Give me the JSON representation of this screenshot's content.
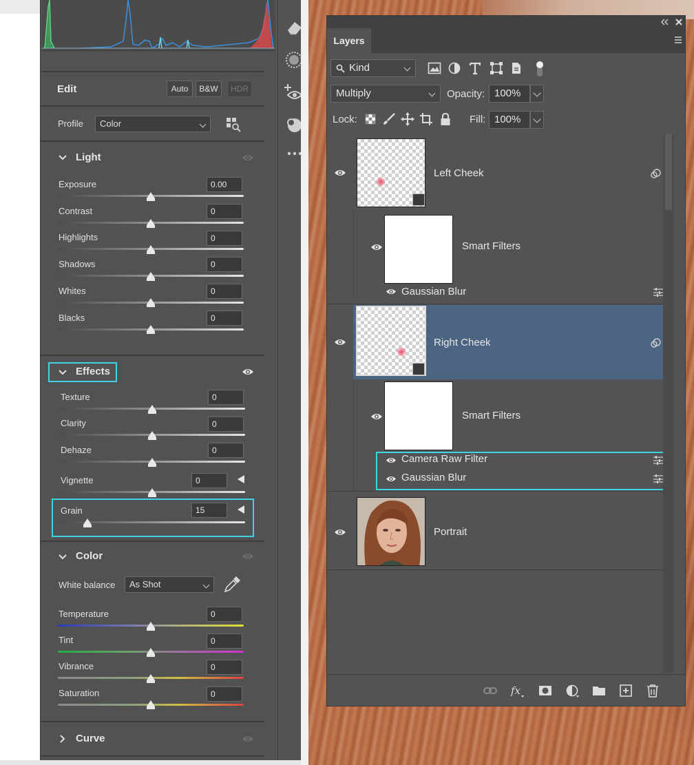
{
  "camera_raw": {
    "edit": {
      "title": "Edit",
      "auto_label": "Auto",
      "bw_label": "B&W",
      "hdr_label": "HDR"
    },
    "profile": {
      "label": "Profile",
      "value": "Color"
    },
    "light": {
      "title": "Light",
      "sliders": [
        {
          "label": "Exposure",
          "value": "0.00",
          "level": 0.5
        },
        {
          "label": "Contrast",
          "value": "0",
          "level": 0.5
        },
        {
          "label": "Highlights",
          "value": "0",
          "level": 0.5
        },
        {
          "label": "Shadows",
          "value": "0",
          "level": 0.5
        },
        {
          "label": "Whites",
          "value": "0",
          "level": 0.5
        },
        {
          "label": "Blacks",
          "value": "0",
          "level": 0.5
        }
      ]
    },
    "effects": {
      "title": "Effects",
      "sliders": [
        {
          "label": "Texture",
          "value": "0",
          "level": 0.5
        },
        {
          "label": "Clarity",
          "value": "0",
          "level": 0.5
        },
        {
          "label": "Dehaze",
          "value": "0",
          "level": 0.5
        },
        {
          "label": "Vignette",
          "value": "0",
          "level": 0.5
        },
        {
          "label": "Grain",
          "value": "15",
          "level": 0.15
        }
      ]
    },
    "color": {
      "title": "Color",
      "white_balance_label": "White balance",
      "white_balance_value": "As Shot",
      "sliders": [
        {
          "label": "Temperature",
          "value": "0",
          "level": 0.5
        },
        {
          "label": "Tint",
          "value": "0",
          "level": 0.5
        },
        {
          "label": "Vibrance",
          "value": "0",
          "level": 0.5
        },
        {
          "label": "Saturation",
          "value": "0",
          "level": 0.5
        }
      ]
    },
    "curve": {
      "title": "Curve"
    },
    "highlight_color": "#3fd3e6"
  },
  "layers_panel": {
    "tab_label": "Layers",
    "filter_kind": "Kind",
    "blend_mode": "Multiply",
    "opacity_label": "Opacity:",
    "opacity_value": "100%",
    "lock_label": "Lock:",
    "fill_label": "Fill:",
    "fill_value": "100%",
    "selected_row_color": "#4b6482",
    "layers": [
      {
        "name": "Left Cheek",
        "type": "smart-object",
        "selected": false
      },
      {
        "name": "Smart Filters",
        "type": "smart-filters"
      },
      {
        "name": "Gaussian Blur",
        "type": "filter"
      },
      {
        "name": "Right Cheek",
        "type": "smart-object",
        "selected": true
      },
      {
        "name": "Smart Filters",
        "type": "smart-filters"
      },
      {
        "name": "Camera Raw Filter",
        "type": "filter"
      },
      {
        "name": "Gaussian Blur",
        "type": "filter"
      },
      {
        "name": "Portrait",
        "type": "image",
        "selected": false
      }
    ]
  }
}
